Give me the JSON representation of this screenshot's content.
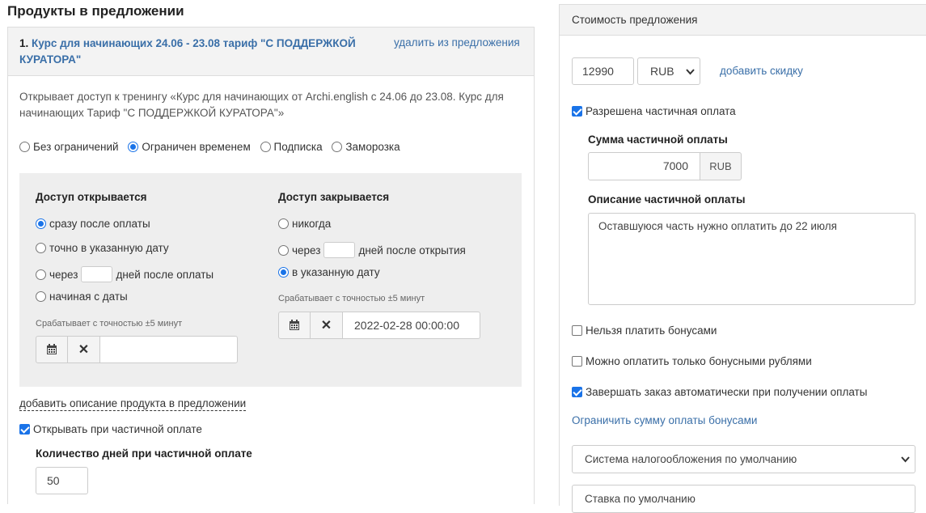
{
  "left": {
    "heading": "Продукты в предложении",
    "product": {
      "number": "1.",
      "title": "Курс для начинающих 24.06 - 23.08 тариф \"С ПОДДЕРЖКОЙ КУРАТОРА\"",
      "remove_link": "удалить из предложения",
      "description": "Открывает доступ к тренингу «Курс для начинающих от Archi.english с 24.06 до 23.08. Курс для начинающих Тариф \"С ПОДДЕРЖКОЙ КУРАТОРА\"»"
    },
    "access_types": [
      {
        "label": "Без ограничений",
        "selected": false
      },
      {
        "label": "Ограничен временем",
        "selected": true
      },
      {
        "label": "Подписка",
        "selected": false
      },
      {
        "label": "Заморозка",
        "selected": false
      }
    ],
    "opens": {
      "title": "Доступ открывается",
      "opt1": "сразу после оплаты",
      "opt2": "точно в указанную дату",
      "opt3_pre": "через",
      "opt3_post": "дней после оплаты",
      "opt4": "начиная с даты",
      "accuracy": "Срабатывает с точностью ±5 минут",
      "date_value": ""
    },
    "closes": {
      "title": "Доступ закрывается",
      "opt1": "никогда",
      "opt2_pre": "через",
      "opt2_post": "дней после открытия",
      "opt3": "в указанную дату",
      "accuracy": "Срабатывает с точностью ±5 минут",
      "date_value": "2022-02-28 00:00:00"
    },
    "add_desc_link": "добавить описание продукта в предложении",
    "partial_open_label": "Открывать при частичной оплате",
    "partial_days_title": "Количество дней при частичной оплате",
    "partial_days_value": "50"
  },
  "right": {
    "header": "Стоимость предложения",
    "price_value": "12990",
    "currency": "RUB",
    "add_discount": "добавить скидку",
    "partial_allowed": "Разрешена частичная оплата",
    "partial_sum_title": "Сумма частичной оплаты",
    "partial_sum_value": "7000",
    "partial_sum_currency": "RUB",
    "partial_desc_title": "Описание частичной оплаты",
    "partial_desc_value": "Оставшуюся часть нужно оплатить до 22 июля",
    "no_bonus": "Нельзя платить бонусами",
    "only_bonus": "Можно оплатить только бонусными рублями",
    "auto_complete": "Завершать заказ автоматически при получении оплаты",
    "limit_bonus_link": "Ограничить сумму оплаты бонусами",
    "tax_system": "Система налогообложения по умолчанию",
    "vat_partial": "Ставка по умолчанию"
  }
}
